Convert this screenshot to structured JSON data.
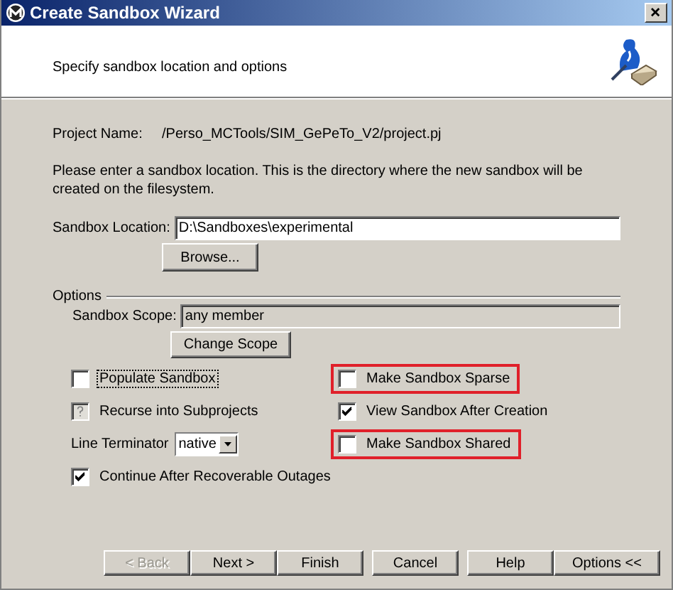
{
  "window": {
    "title": "Create Sandbox Wizard"
  },
  "header": {
    "subtitle": "Specify sandbox location and options"
  },
  "project": {
    "label": "Project Name:",
    "value": "/Perso_MCTools/SIM_GePeTo_V2/project.pj"
  },
  "instructions": "Please enter a sandbox location.  This is the directory where the new sandbox will be created on the filesystem.",
  "location": {
    "label": "Sandbox Location:",
    "value": "D:\\Sandboxes\\experimental",
    "button": "Browse..."
  },
  "options": {
    "title": "Options",
    "scope": {
      "label": "Sandbox Scope:",
      "value": "any member",
      "disabled": true,
      "button": "Change Scope"
    },
    "items": [
      {
        "kind": "checkbox",
        "label": "Populate Sandbox",
        "checked": false,
        "mixed": false,
        "focused": true,
        "highlighted": false
      },
      {
        "kind": "checkbox",
        "label": "Make Sandbox Sparse",
        "checked": false,
        "mixed": false,
        "focused": false,
        "highlighted": true
      },
      {
        "kind": "checkbox",
        "label": "Recurse into Subprojects",
        "checked": false,
        "mixed": true,
        "focused": false,
        "highlighted": false
      },
      {
        "kind": "checkbox",
        "label": "View Sandbox After Creation",
        "checked": true,
        "mixed": false,
        "focused": false,
        "highlighted": false
      },
      {
        "kind": "dropdown",
        "label": "Line Terminator",
        "value": "native"
      },
      {
        "kind": "checkbox",
        "label": "Make Sandbox Shared",
        "checked": false,
        "mixed": false,
        "focused": false,
        "highlighted": true
      },
      {
        "kind": "checkbox",
        "label": "Continue After Recoverable Outages",
        "checked": true,
        "mixed": false,
        "focused": false,
        "highlighted": false
      }
    ]
  },
  "buttons": [
    {
      "label": "< Back",
      "disabled": true
    },
    {
      "label": "Next >",
      "disabled": false
    },
    {
      "label": "Finish",
      "disabled": false
    },
    {
      "label": "Cancel",
      "disabled": false
    },
    {
      "label": "Help",
      "disabled": false
    },
    {
      "label": "Options <<",
      "disabled": false
    }
  ]
}
